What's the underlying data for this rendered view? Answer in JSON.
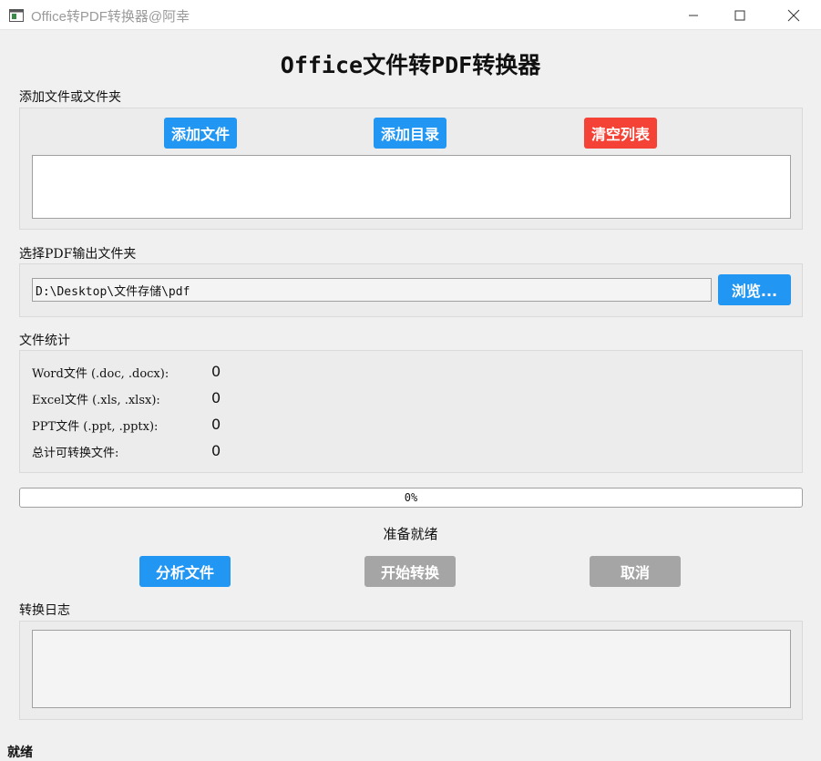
{
  "window": {
    "title": "Office转PDF转换器@阿幸"
  },
  "header": {
    "title": "Office文件转PDF转换器"
  },
  "add_section": {
    "label": "添加文件或文件夹",
    "add_files_button": "添加文件",
    "add_dir_button": "添加目录",
    "clear_list_button": "清空列表",
    "file_list": []
  },
  "output_section": {
    "label": "选择PDF输出文件夹",
    "path_value": "D:\\Desktop\\文件存储\\pdf",
    "browse_button": "浏览..."
  },
  "stats_section": {
    "label": "文件统计",
    "rows": [
      {
        "label": "Word文件 (.doc, .docx):",
        "value": "0"
      },
      {
        "label": "Excel文件 (.xls, .xlsx):",
        "value": "0"
      },
      {
        "label": "PPT文件 (.ppt, .pptx):",
        "value": "0"
      },
      {
        "label": "总计可转换文件:",
        "value": "0"
      }
    ]
  },
  "progress": {
    "value": 0,
    "text": "0%"
  },
  "status": {
    "text": "准备就绪"
  },
  "actions": {
    "analyze_button": "分析文件",
    "start_button": "开始转换",
    "cancel_button": "取消"
  },
  "log_section": {
    "label": "转换日志",
    "content": ""
  },
  "statusbar": {
    "text": "就绪"
  },
  "colors": {
    "primary": "#2196f3",
    "danger": "#f44336",
    "disabled": "#a5a5a5"
  }
}
